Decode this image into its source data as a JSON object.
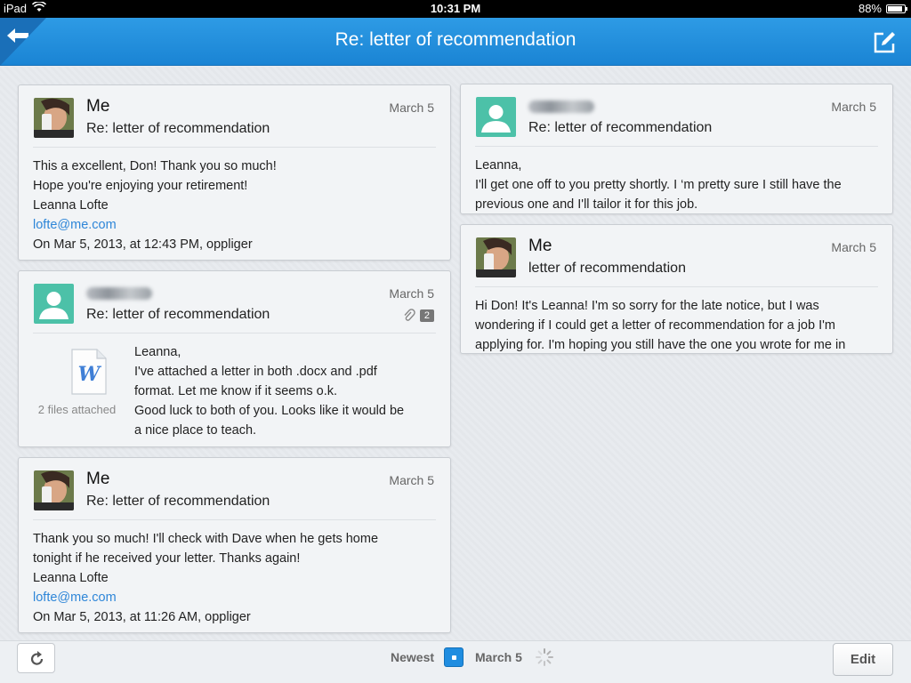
{
  "status_bar": {
    "device": "iPad",
    "time": "10:31 PM",
    "battery": "88%",
    "battery_level": 0.88
  },
  "nav": {
    "title": "Re: letter of recommendation"
  },
  "cards": [
    {
      "sender": "Me",
      "subject": "Re: letter of recommendation",
      "date": "March 5",
      "lines": [
        "This a excellent, Don! Thank you so much!",
        "Hope you're enjoying your retirement!",
        "Leanna Lofte"
      ],
      "link": "lofte@me.com",
      "footer": "On Mar 5, 2013, at 12:43 PM, oppliger"
    },
    {
      "subject": "Re: letter of recommendation",
      "date": "March 5",
      "attachment_count": "2",
      "files_label": "2 files attached",
      "lines": [
        "Leanna,",
        "I've attached a letter in both .docx and .pdf",
        "format. Let me know if it seems o.k.",
        "Good luck to both of you. Looks like it would be",
        "a nice place to teach."
      ]
    },
    {
      "sender": "Me",
      "subject": "Re: letter of recommendation",
      "date": "March 5",
      "lines": [
        "Thank you so much! I'll check with Dave when he gets home",
        "tonight if he received your letter. Thanks again!",
        "Leanna Lofte"
      ],
      "link": "lofte@me.com",
      "footer": "On Mar 5, 2013, at 11:26 AM, oppliger"
    },
    {
      "subject": "Re: letter of recommendation",
      "date": "March 5",
      "lines": [
        "Leanna,",
        "I'll get one off to you pretty shortly. I ‘m pretty sure I still have the",
        "previous one and I'll tailor it for this job."
      ]
    },
    {
      "sender": "Me",
      "subject": "letter of recommendation",
      "date": "March 5",
      "lines": [
        "Hi Don! It's Leanna! I'm so sorry for the late notice, but I was",
        "wondering if I could get a letter of recommendation for a job I'm",
        "applying for. I'm hoping you still have the one you wrote for me in"
      ]
    }
  ],
  "toolbar": {
    "newest_label": "Newest",
    "date_label": "March 5",
    "edit_label": "Edit"
  },
  "colors": {
    "accent": "#1f8de0",
    "link": "#2e86d8",
    "avatar_teal": "#4cc1a8"
  }
}
